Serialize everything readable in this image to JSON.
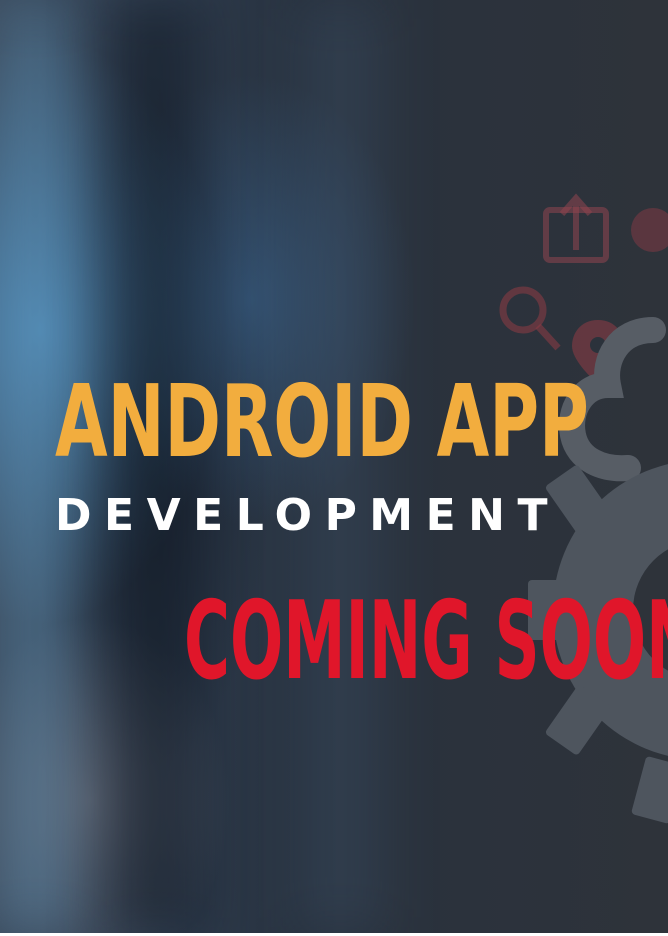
{
  "poster": {
    "title": "ANDROID APP",
    "subtitle": "DEVELOPMENT",
    "status": "COMING SOON"
  },
  "icons": [
    "cloud-icon",
    "gear-icon",
    "upload-icon",
    "location-pin-icon",
    "search-icon"
  ],
  "colors": {
    "title": "#f2ad3e",
    "subtitle": "#ffffff",
    "status": "#e0162a",
    "background": "#2b323c"
  }
}
